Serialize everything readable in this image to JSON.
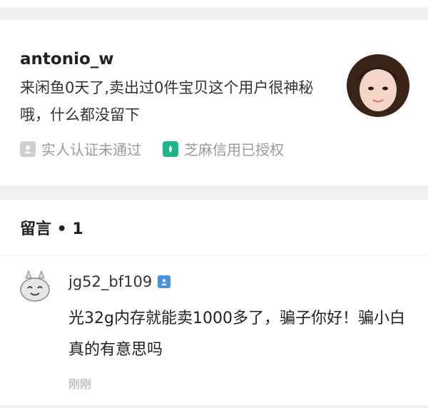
{
  "seller": {
    "username": "antonio_w",
    "description": "来闲鱼0天了,卖出过0件宝贝这个用户很神秘哦，什么都没留下",
    "badges": [
      {
        "label": "实人认证未通过",
        "icon": "person-verify-icon",
        "color": "#cfcfcf"
      },
      {
        "label": "芝麻信用已授权",
        "icon": "sesame-credit-icon",
        "color": "#1fb58b"
      }
    ]
  },
  "comments": {
    "title": "留言 • 1",
    "items": [
      {
        "username": "jg52_bf109",
        "text": "光32g内存就能卖1000多了，骗子你好！骗小白真的有意思吗",
        "time": "刚刚"
      }
    ]
  }
}
